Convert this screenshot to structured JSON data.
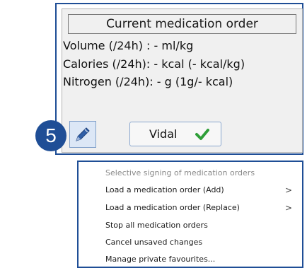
{
  "panel": {
    "title": "Current medication order",
    "volume_line": "Volume (/24h) : - ml/kg",
    "calories_line": "Calories (/24h): - kcal (- kcal/kg)",
    "nitrogen_line": "Nitrogen (/24h): - g (1g/- kcal)",
    "edit_icon": "pencil-icon",
    "vidal_button_label": "Vidal",
    "vidal_status_icon": "checkmark-icon",
    "check_color": "#2e9e38"
  },
  "step_badge": {
    "number": "5",
    "color": "#1f4e96"
  },
  "context_menu": {
    "items": [
      {
        "label": "Selective signing of medication orders",
        "enabled": false,
        "submenu": false
      },
      {
        "label": "Load a medication order (Add)",
        "enabled": true,
        "submenu": true,
        "arrow": ">"
      },
      {
        "label": "Load a medication order (Replace)",
        "enabled": true,
        "submenu": true,
        "arrow": ">"
      },
      {
        "label": "Stop all medication orders",
        "enabled": true,
        "submenu": false
      },
      {
        "label": "Cancel unsaved changes",
        "enabled": true,
        "submenu": false
      },
      {
        "label": "Manage private favourites...",
        "enabled": true,
        "submenu": false
      }
    ]
  },
  "accent_color": "#1f4e96"
}
